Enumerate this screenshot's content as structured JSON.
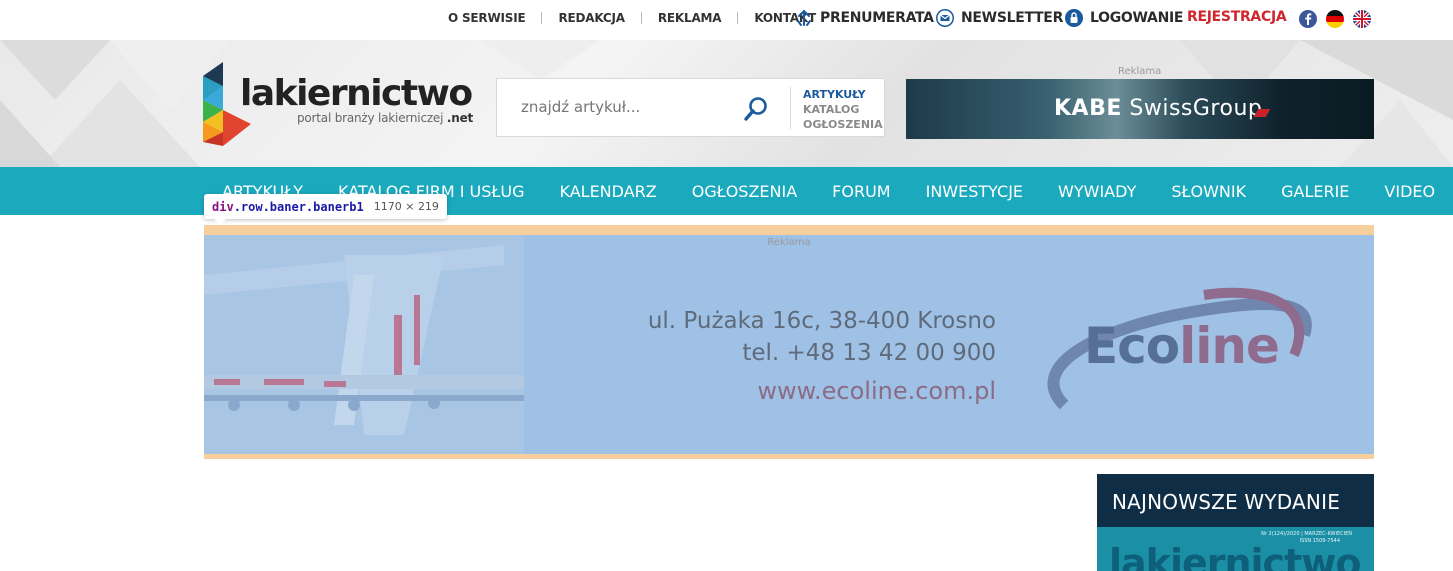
{
  "topbar": {
    "links": [
      "O SERWISIE",
      "REDAKCJA",
      "REKLAMA",
      "KONTAKT"
    ],
    "subscribe": "PRENUMERATA",
    "newsletter": "NEWSLETTER",
    "login": "LOGOWANIE",
    "register": "REJESTRACJA",
    "social_icons": [
      "facebook-icon",
      "german-flag-icon",
      "uk-flag-icon"
    ]
  },
  "logo": {
    "wordmark": "lakiernictwo",
    "tagline": "portal branży lakierniczej",
    "tld": ".net"
  },
  "search": {
    "placeholder": "znajdź artykuł...",
    "scopes": [
      "ARTYKUŁY",
      "KATALOG",
      "OGŁOSZENIA"
    ],
    "active_scope": "ARTYKUŁY"
  },
  "top_ad": {
    "label": "Reklama",
    "brand_bold": "KABE",
    "brand_rest": "SwissGroup"
  },
  "nav": {
    "items": [
      "ARTYKUŁY",
      "KATALOG FIRM I USŁUG",
      "KALENDARZ",
      "OGŁOSZENIA",
      "FORUM",
      "INWESTYCJE",
      "WYWIADY",
      "SŁOWNIK",
      "GALERIE",
      "VIDEO"
    ]
  },
  "inspector": {
    "selector_tag": "div",
    "selector_classes": ".row.baner.banerb1",
    "dimensions": "1170 × 219"
  },
  "banner": {
    "label": "Reklama",
    "address_line1": "ul. Pużaka 16c, 38-400 Krosno",
    "address_line2": "tel. +48 13 42 00 900",
    "website": "www.ecoline.com.pl",
    "brand_a": "Eco",
    "brand_b": "line"
  },
  "sidebar": {
    "latest_issue_title": "NAJNOWSZE WYDANIE",
    "cover_masthead": "lakiernictwo",
    "cover_small_1": "Nr 2(124)/2020 | MARZEC-KWIECIEŃ",
    "cover_small_2": "ISSN 1509-7544"
  },
  "colors": {
    "nav_bg": "#1ba9be",
    "register": "#d0262d",
    "banner_highlight": "#9fc1e6",
    "banner_margin": "#f7cf9d",
    "issue_bg": "#0f2d44"
  }
}
